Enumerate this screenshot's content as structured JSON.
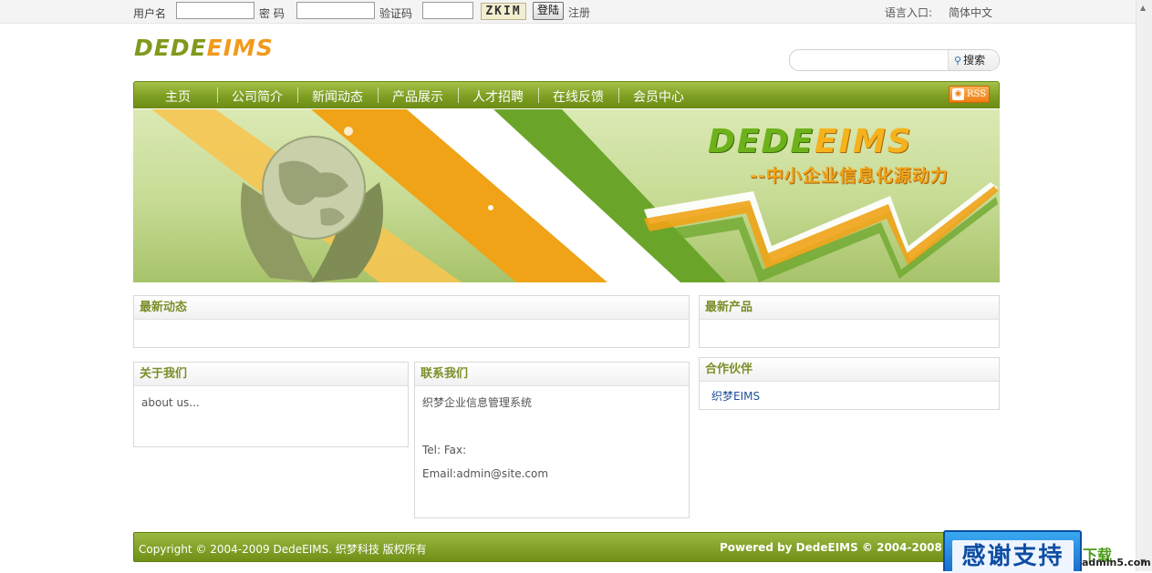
{
  "topbar": {
    "username_label": "用户名",
    "password_label": "密 码",
    "captcha_label": "验证码",
    "captcha_code": "ZKIM",
    "login_button": "登陆",
    "register_link": "注册",
    "language_label": "语言入口:",
    "language_value": "简体中文"
  },
  "header": {
    "logo_part1": "DEDE",
    "logo_part2": "EIMS",
    "search_button": "搜索",
    "search_value": ""
  },
  "nav": {
    "items": [
      "主页",
      "公司简介",
      "新闻动态",
      "产品展示",
      "人才招聘",
      "在线反馈",
      "会员中心"
    ],
    "rss_label": "RSS"
  },
  "banner": {
    "logo_part1": "DEDE",
    "logo_part2": "EIMS",
    "slogan": "--中小企业信息化源动力"
  },
  "sections": {
    "news_title": "最新动态",
    "products_title": "最新产品",
    "about_title": "关于我们",
    "about_text": "about us...",
    "contact_title": "联系我们",
    "contact_company": "织梦企业信息管理系统",
    "contact_tel": "Tel: Fax:",
    "contact_email": "Email:admin@site.com",
    "partners_title": "合作伙伴",
    "partner_link": "织梦EIMS"
  },
  "footer": {
    "copyright": "Copyright © 2004-2009 DedeEIMS. 织梦科技 版权所有",
    "powered": "Powered by DedeEIMS © 2004-2008 De"
  },
  "overlay": {
    "badge_text": "感谢支持",
    "site_mark": "下载",
    "site_url": "admin5.com"
  },
  "colors": {
    "brand_green": "#7e9f22",
    "brand_orange": "#f29a1c",
    "heading_green": "#7a8f2a",
    "link_blue": "#1f4f96"
  }
}
